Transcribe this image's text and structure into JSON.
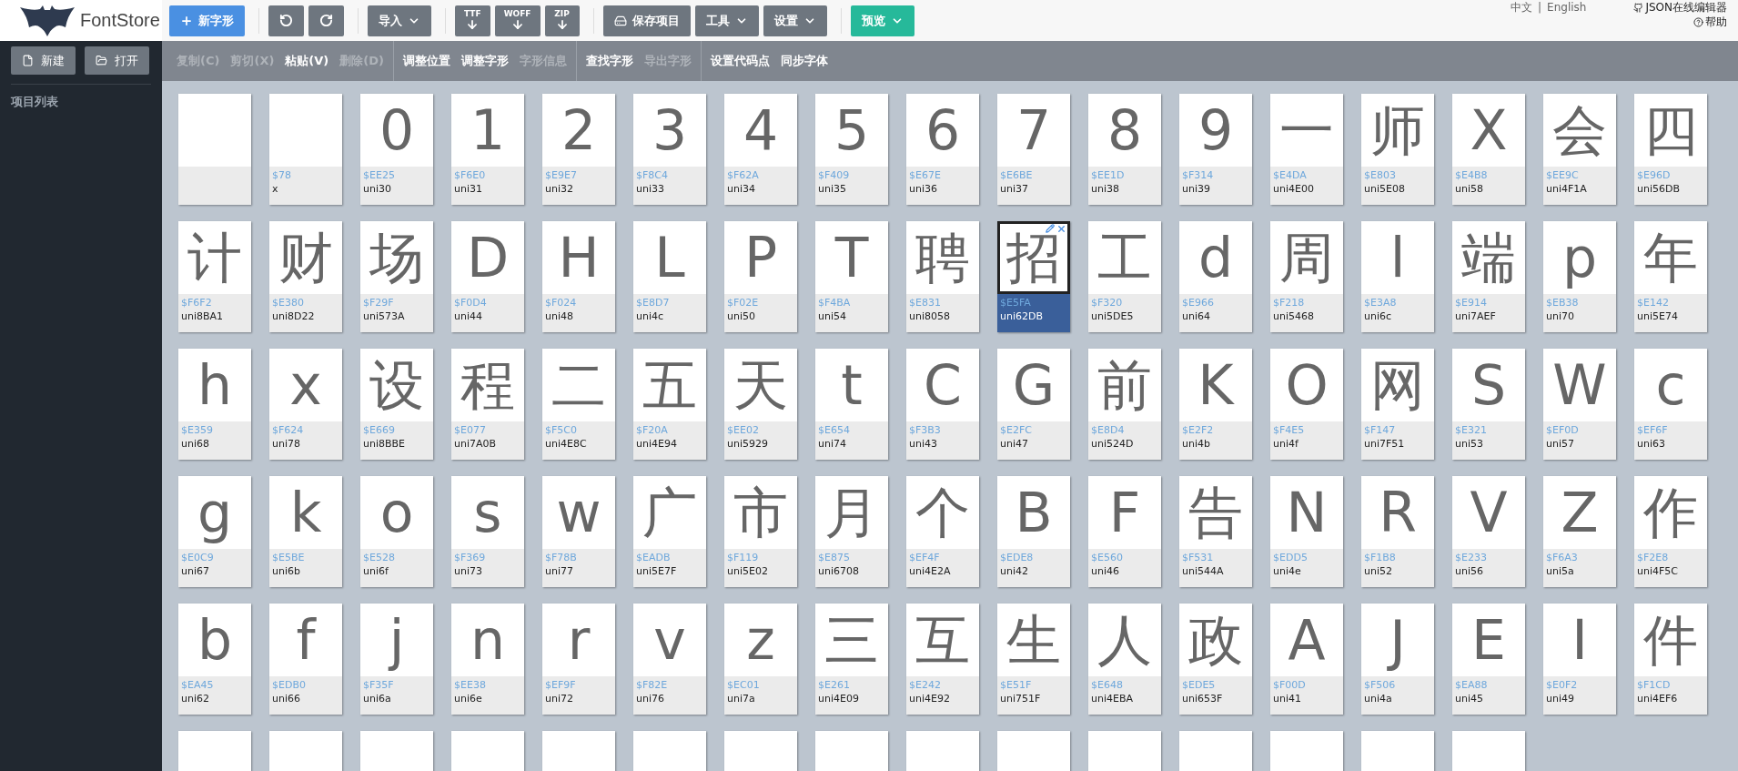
{
  "app": {
    "name": "FontStore"
  },
  "toolbar": [
    {
      "kind": "primary",
      "label": "新字形"
    },
    {
      "kind": "undo"
    },
    {
      "kind": "redo"
    },
    {
      "kind": "dropdown",
      "label": "导入"
    },
    {
      "kind": "export",
      "label": "TTF"
    },
    {
      "kind": "export",
      "label": "WOFF"
    },
    {
      "kind": "export",
      "label": "ZIP"
    },
    {
      "kind": "save",
      "label": "保存项目"
    },
    {
      "kind": "dropdown",
      "label": "工具"
    },
    {
      "kind": "dropdown",
      "label": "设置"
    },
    {
      "kind": "preview",
      "label": "预览"
    }
  ],
  "top_links": {
    "languages": [
      "中文",
      "English"
    ],
    "separator": "|",
    "editor_link": "JSON在线编辑器",
    "help": "帮助"
  },
  "sidebar": {
    "buttons": [
      {
        "kind": "new",
        "label": "新建"
      },
      {
        "kind": "open",
        "label": "打开"
      }
    ],
    "heading": "项目列表"
  },
  "commands": [
    [
      {
        "label": "复制(C)",
        "disabled": true
      },
      {
        "label": "剪切(X)",
        "disabled": true
      },
      {
        "label": "粘贴(V)",
        "disabled": false
      },
      {
        "label": "删除(D)",
        "disabled": true
      }
    ],
    [
      {
        "label": "调整位置",
        "disabled": false
      },
      {
        "label": "调整字形",
        "disabled": false
      },
      {
        "label": "字形信息",
        "disabled": true
      }
    ],
    [
      {
        "label": "查找字形",
        "disabled": false
      },
      {
        "label": "导出字形",
        "disabled": true
      }
    ],
    [
      {
        "label": "设置代码点",
        "disabled": false
      },
      {
        "label": "同步字体",
        "disabled": false
      }
    ]
  ],
  "glyphs": [
    {
      "selected": false
    },
    {
      "code": "$78",
      "name": "x",
      "selected": false
    },
    {
      "glyph": "0",
      "code": "$EE25",
      "name": "uni30",
      "selected": false
    },
    {
      "glyph": "1",
      "code": "$F6E0",
      "name": "uni31",
      "selected": false
    },
    {
      "glyph": "2",
      "code": "$E9E7",
      "name": "uni32",
      "selected": false
    },
    {
      "glyph": "3",
      "code": "$F8C4",
      "name": "uni33",
      "selected": false
    },
    {
      "glyph": "4",
      "code": "$F62A",
      "name": "uni34",
      "selected": false
    },
    {
      "glyph": "5",
      "code": "$F409",
      "name": "uni35",
      "selected": false
    },
    {
      "glyph": "6",
      "code": "$E67E",
      "name": "uni36",
      "selected": false
    },
    {
      "glyph": "7",
      "code": "$E6BE",
      "name": "uni37",
      "selected": false
    },
    {
      "glyph": "8",
      "code": "$EE1D",
      "name": "uni38",
      "selected": false
    },
    {
      "glyph": "9",
      "code": "$F314",
      "name": "uni39",
      "selected": false
    },
    {
      "glyph": "一",
      "code": "$E4DA",
      "name": "uni4E00",
      "selected": false
    },
    {
      "glyph": "师",
      "code": "$E803",
      "name": "uni5E08",
      "selected": false
    },
    {
      "glyph": "X",
      "code": "$E4B8",
      "name": "uni58",
      "selected": false
    },
    {
      "glyph": "会",
      "code": "$EE9C",
      "name": "uni4F1A",
      "selected": false
    },
    {
      "glyph": "四",
      "code": "$E96D",
      "name": "uni56DB",
      "selected": false
    },
    {
      "glyph": "计",
      "code": "$F6F2",
      "name": "uni8BA1",
      "selected": false
    },
    {
      "glyph": "财",
      "code": "$E380",
      "name": "uni8D22",
      "selected": false
    },
    {
      "glyph": "场",
      "code": "$F29F",
      "name": "uni573A",
      "selected": false
    },
    {
      "glyph": "D",
      "code": "$F0D4",
      "name": "uni44",
      "selected": false
    },
    {
      "glyph": "H",
      "code": "$F024",
      "name": "uni48",
      "selected": false
    },
    {
      "glyph": "L",
      "code": "$E8D7",
      "name": "uni4c",
      "selected": false
    },
    {
      "glyph": "P",
      "code": "$F02E",
      "name": "uni50",
      "selected": false
    },
    {
      "glyph": "T",
      "code": "$F4BA",
      "name": "uni54",
      "selected": false
    },
    {
      "glyph": "聘",
      "code": "$E831",
      "name": "uni8058",
      "selected": false
    },
    {
      "glyph": "招",
      "code": "$E5FA",
      "name": "uni62DB",
      "selected": true
    },
    {
      "glyph": "工",
      "code": "$F320",
      "name": "uni5DE5",
      "selected": false
    },
    {
      "glyph": "d",
      "code": "$E966",
      "name": "uni64",
      "selected": false
    },
    {
      "glyph": "周",
      "code": "$F218",
      "name": "uni5468",
      "selected": false
    },
    {
      "glyph": "l",
      "code": "$E3A8",
      "name": "uni6c",
      "selected": false
    },
    {
      "glyph": "端",
      "code": "$E914",
      "name": "uni7AEF",
      "selected": false
    },
    {
      "glyph": "p",
      "code": "$EB38",
      "name": "uni70",
      "selected": false
    },
    {
      "glyph": "年",
      "code": "$E142",
      "name": "uni5E74",
      "selected": false
    },
    {
      "glyph": "h",
      "code": "$E359",
      "name": "uni68",
      "selected": false
    },
    {
      "glyph": "x",
      "code": "$F624",
      "name": "uni78",
      "selected": false
    },
    {
      "glyph": "设",
      "code": "$E669",
      "name": "uni8BBE",
      "selected": false
    },
    {
      "glyph": "程",
      "code": "$E077",
      "name": "uni7A0B",
      "selected": false
    },
    {
      "glyph": "二",
      "code": "$F5C0",
      "name": "uni4E8C",
      "selected": false
    },
    {
      "glyph": "五",
      "code": "$F20A",
      "name": "uni4E94",
      "selected": false
    },
    {
      "glyph": "天",
      "code": "$EE02",
      "name": "uni5929",
      "selected": false
    },
    {
      "glyph": "t",
      "code": "$E654",
      "name": "uni74",
      "selected": false
    },
    {
      "glyph": "C",
      "code": "$F3B3",
      "name": "uni43",
      "selected": false
    },
    {
      "glyph": "G",
      "code": "$E2FC",
      "name": "uni47",
      "selected": false
    },
    {
      "glyph": "前",
      "code": "$E8D4",
      "name": "uni524D",
      "selected": false
    },
    {
      "glyph": "K",
      "code": "$E2F2",
      "name": "uni4b",
      "selected": false
    },
    {
      "glyph": "O",
      "code": "$F4E5",
      "name": "uni4f",
      "selected": false
    },
    {
      "glyph": "网",
      "code": "$F147",
      "name": "uni7F51",
      "selected": false
    },
    {
      "glyph": "S",
      "code": "$E321",
      "name": "uni53",
      "selected": false
    },
    {
      "glyph": "W",
      "code": "$EF0D",
      "name": "uni57",
      "selected": false
    },
    {
      "glyph": "c",
      "code": "$EF6F",
      "name": "uni63",
      "selected": false
    },
    {
      "glyph": "g",
      "code": "$E0C9",
      "name": "uni67",
      "selected": false
    },
    {
      "glyph": "k",
      "code": "$E5BE",
      "name": "uni6b",
      "selected": false
    },
    {
      "glyph": "o",
      "code": "$E528",
      "name": "uni6f",
      "selected": false
    },
    {
      "glyph": "s",
      "code": "$F369",
      "name": "uni73",
      "selected": false
    },
    {
      "glyph": "w",
      "code": "$F78B",
      "name": "uni77",
      "selected": false
    },
    {
      "glyph": "广",
      "code": "$EADB",
      "name": "uni5E7F",
      "selected": false
    },
    {
      "glyph": "市",
      "code": "$F119",
      "name": "uni5E02",
      "selected": false
    },
    {
      "glyph": "月",
      "code": "$E875",
      "name": "uni6708",
      "selected": false
    },
    {
      "glyph": "个",
      "code": "$EF4F",
      "name": "uni4E2A",
      "selected": false
    },
    {
      "glyph": "B",
      "code": "$EDE8",
      "name": "uni42",
      "selected": false
    },
    {
      "glyph": "F",
      "code": "$E560",
      "name": "uni46",
      "selected": false
    },
    {
      "glyph": "告",
      "code": "$F531",
      "name": "uni544A",
      "selected": false
    },
    {
      "glyph": "N",
      "code": "$EDD5",
      "name": "uni4e",
      "selected": false
    },
    {
      "glyph": "R",
      "code": "$F1B8",
      "name": "uni52",
      "selected": false
    },
    {
      "glyph": "V",
      "code": "$E233",
      "name": "uni56",
      "selected": false
    },
    {
      "glyph": "Z",
      "code": "$F6A3",
      "name": "uni5a",
      "selected": false
    },
    {
      "glyph": "作",
      "code": "$F2E8",
      "name": "uni4F5C",
      "selected": false
    },
    {
      "glyph": "b",
      "code": "$EA45",
      "name": "uni62",
      "selected": false
    },
    {
      "glyph": "f",
      "code": "$EDB0",
      "name": "uni66",
      "selected": false
    },
    {
      "glyph": "j",
      "code": "$F35F",
      "name": "uni6a",
      "selected": false
    },
    {
      "glyph": "n",
      "code": "$EE38",
      "name": "uni6e",
      "selected": false
    },
    {
      "glyph": "r",
      "code": "$EF9F",
      "name": "uni72",
      "selected": false
    },
    {
      "glyph": "v",
      "code": "$F82E",
      "name": "uni76",
      "selected": false
    },
    {
      "glyph": "z",
      "code": "$EC01",
      "name": "uni7a",
      "selected": false
    },
    {
      "glyph": "三",
      "code": "$E261",
      "name": "uni4E09",
      "selected": false
    },
    {
      "glyph": "互",
      "code": "$E242",
      "name": "uni4E92",
      "selected": false
    },
    {
      "glyph": "生",
      "code": "$E51F",
      "name": "uni751F",
      "selected": false
    },
    {
      "glyph": "人",
      "code": "$E648",
      "name": "uni4EBA",
      "selected": false
    },
    {
      "glyph": "政",
      "code": "$EDE5",
      "name": "uni653F",
      "selected": false
    },
    {
      "glyph": "A",
      "code": "$F00D",
      "name": "uni41",
      "selected": false
    },
    {
      "glyph": "J",
      "code": "$F506",
      "name": "uni4a",
      "selected": false
    },
    {
      "glyph": "E",
      "code": "$EA88",
      "name": "uni45",
      "selected": false
    },
    {
      "glyph": "I",
      "code": "$E0F2",
      "name": "uni49",
      "selected": false
    },
    {
      "glyph": "件",
      "code": "$F1CD",
      "name": "uni4EF6",
      "selected": false
    },
    {
      "selected": false
    },
    {
      "selected": false
    },
    {
      "selected": false
    },
    {
      "selected": false
    },
    {
      "selected": false
    },
    {
      "selected": false
    },
    {
      "selected": false
    },
    {
      "selected": false
    },
    {
      "selected": false
    },
    {
      "selected": false
    },
    {
      "selected": false
    },
    {
      "selected": false
    },
    {
      "selected": false
    },
    {
      "selected": false
    },
    {
      "selected": false
    }
  ]
}
